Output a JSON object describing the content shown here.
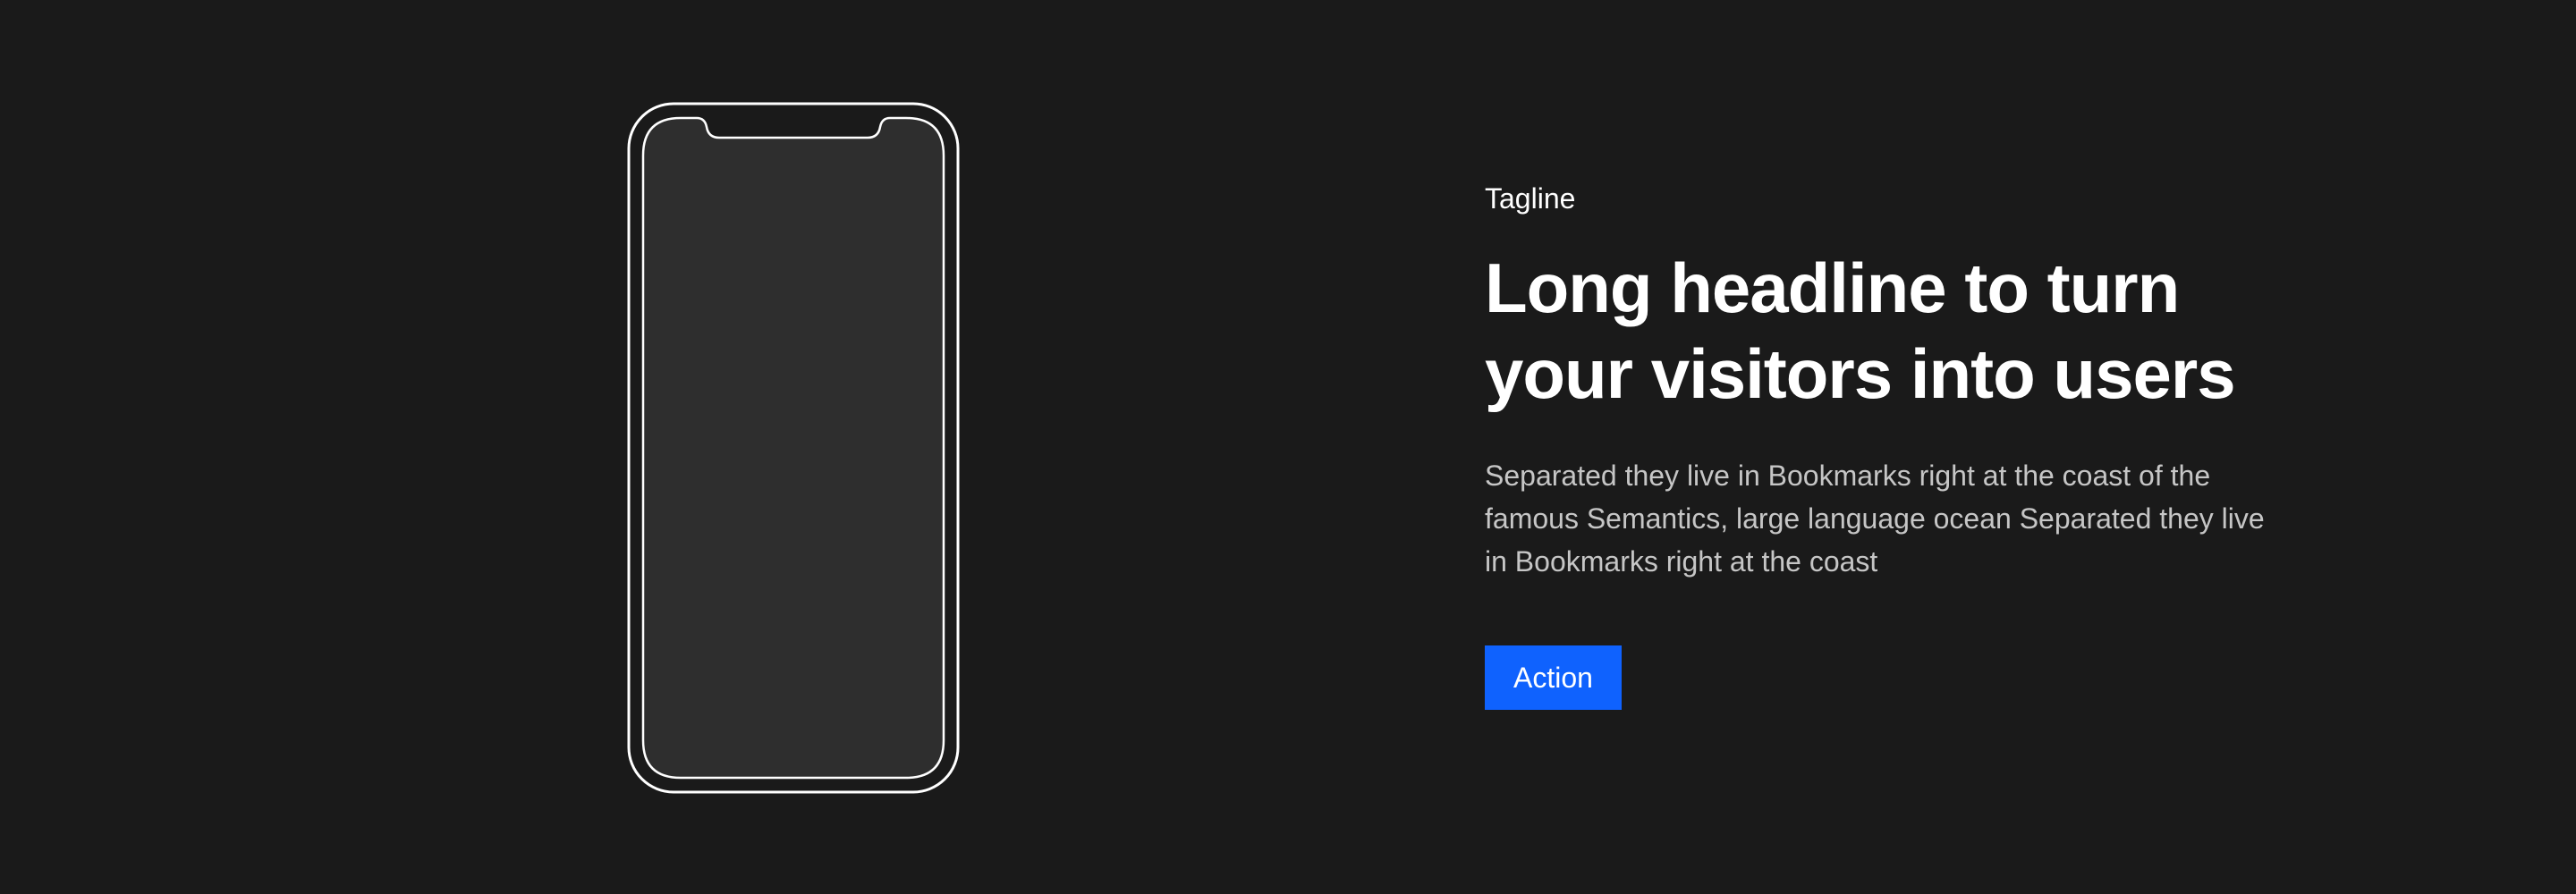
{
  "hero": {
    "tagline": "Tagline",
    "headline_line1": "Long headline to turn",
    "headline_line2": "your visitors into users",
    "description": "Separated they live in Bookmarks right at the coast of the famous Semantics, large language ocean Separated they live in Bookmarks right at the coast",
    "action_label": "Action"
  },
  "colors": {
    "background": "#1a1a1a",
    "screen": "#2e2e2e",
    "outline": "#ffffff",
    "button": "#0f62fe",
    "text": "#ffffff",
    "body_text": "#c6c6c6"
  },
  "illustration": {
    "icon": "smartphone-outline-icon"
  }
}
